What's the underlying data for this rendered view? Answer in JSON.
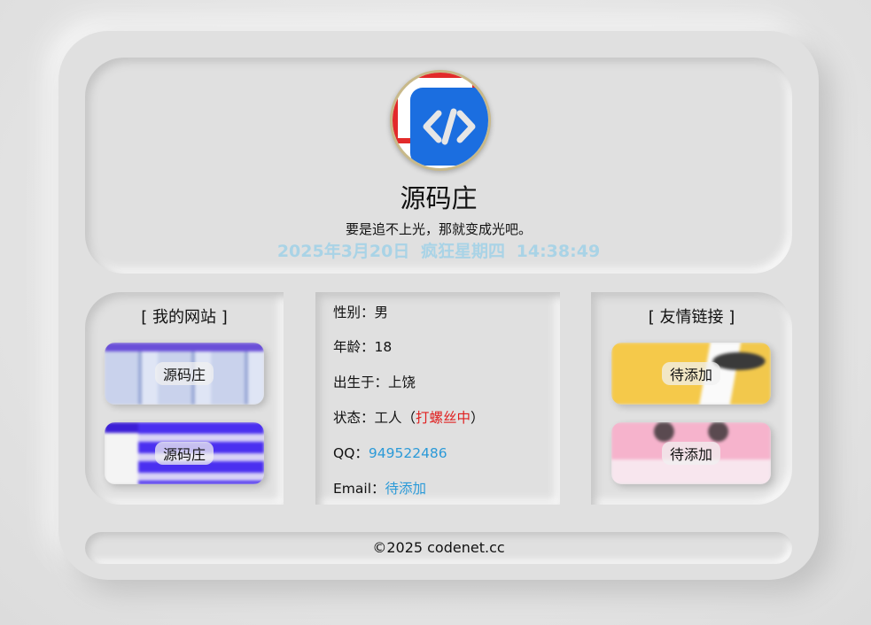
{
  "profile": {
    "name": "源码庄",
    "motto": "要是追不上光，那就变成光吧。",
    "clock": {
      "date": "2025年3月20日",
      "weekday": "疯狂星期四",
      "time": "14:38:49"
    }
  },
  "my_sites": {
    "title": "[ 我的网站 ]",
    "items": [
      {
        "label": "源码庄"
      },
      {
        "label": "源码庄"
      }
    ]
  },
  "info": {
    "gender": {
      "key": "性别：",
      "value": "男"
    },
    "age": {
      "key": "年龄：",
      "value": "18"
    },
    "birthplace": {
      "key": "出生于：",
      "value": "上饶"
    },
    "status": {
      "key": "状态：",
      "value": "工人（",
      "highlight": "打螺丝中",
      "close": "）"
    },
    "qq": {
      "key": "QQ：",
      "value": "949522486"
    },
    "email": {
      "key": "Email：",
      "value": "待添加"
    }
  },
  "friends": {
    "title": "[ 友情链接 ]",
    "items": [
      {
        "label": "待添加"
      },
      {
        "label": "待添加"
      }
    ]
  },
  "footer": {
    "copyright": "©2025 codenet.cc"
  },
  "colors": {
    "background": "#e0e0e0",
    "clock": "#a9d3e6",
    "link": "#2b9ad8",
    "highlight": "#e02020",
    "avatar_tile": "#1b6ee0"
  },
  "icons": {
    "avatar": "code-brackets-icon"
  }
}
